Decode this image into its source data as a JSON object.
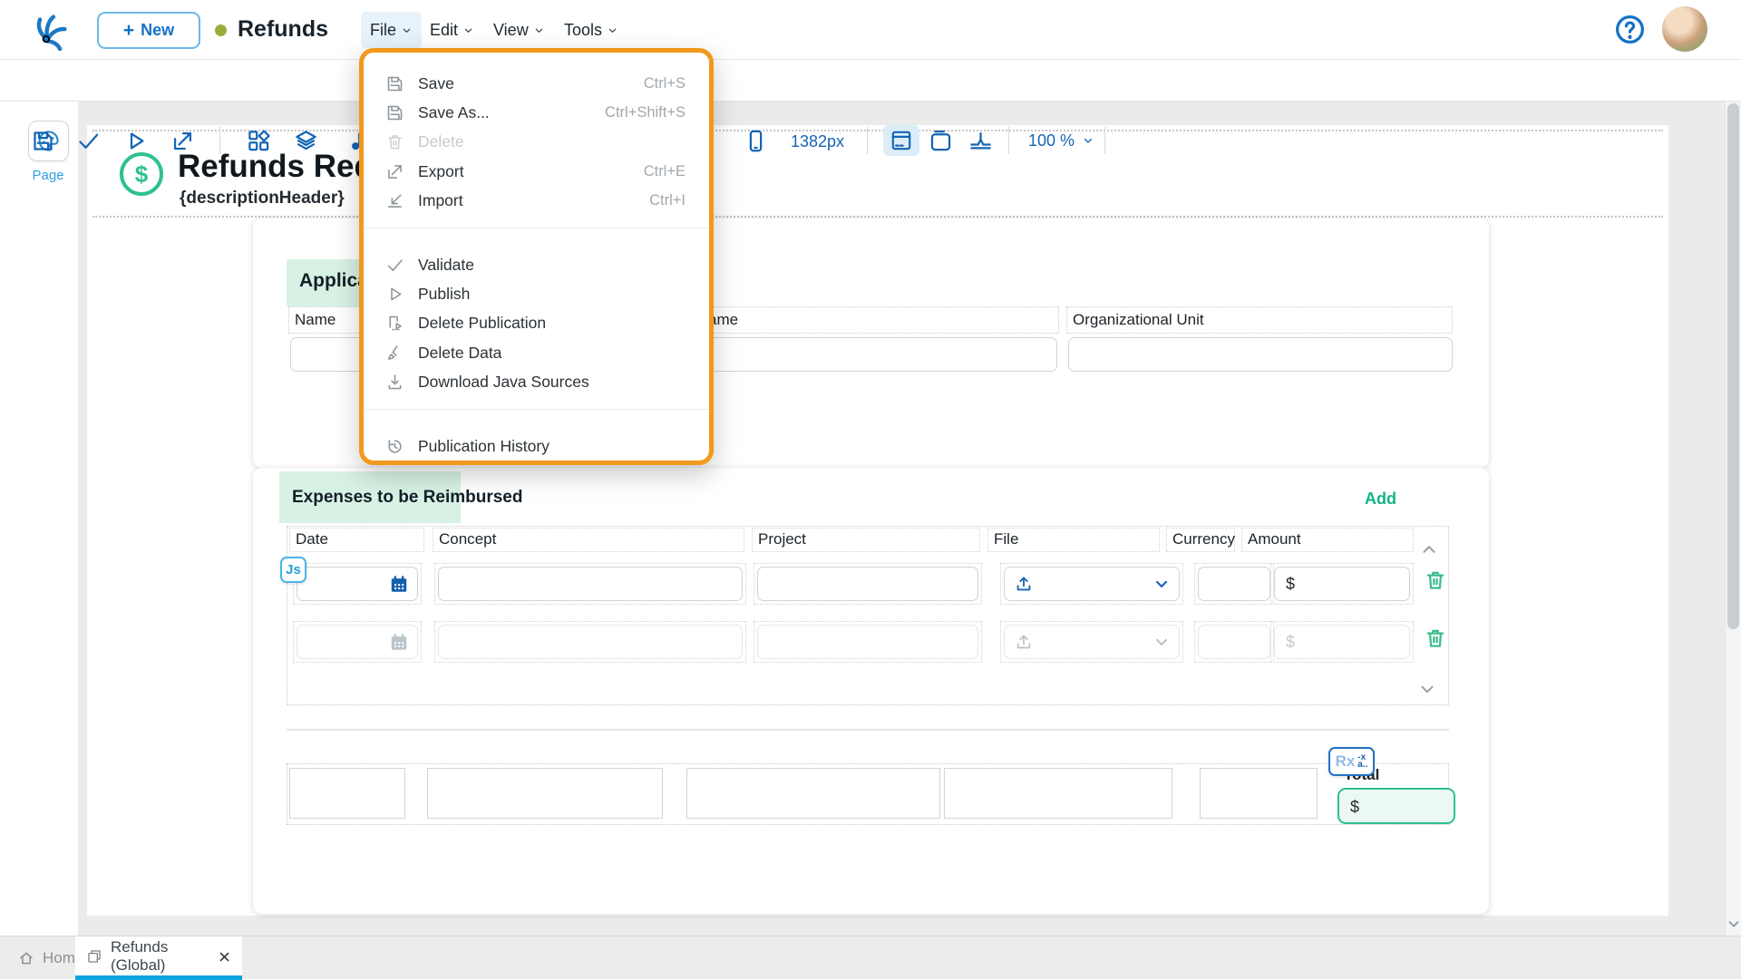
{
  "navbar": {
    "new_button_plus": "+",
    "new_button_label": "New",
    "app_title": "Refunds",
    "menus": [
      {
        "label": "File"
      },
      {
        "label": "Edit"
      },
      {
        "label": "View"
      },
      {
        "label": "Tools"
      }
    ],
    "active_menu": "File"
  },
  "toolbar": {
    "canvas_width_label": "1382px",
    "zoom_label": "100 %"
  },
  "file_menu": {
    "items": [
      {
        "label": "Save",
        "shortcut": "Ctrl+S"
      },
      {
        "label": "Save As...",
        "shortcut": "Ctrl+Shift+S"
      },
      {
        "label": "Delete",
        "disabled": true
      },
      {
        "label": "Export",
        "shortcut": "Ctrl+E"
      },
      {
        "label": "Import",
        "shortcut": "Ctrl+I"
      },
      {
        "label": "Validate"
      },
      {
        "label": "Publish"
      },
      {
        "label": "Delete Publication"
      },
      {
        "label": "Delete Data"
      },
      {
        "label": "Download Java Sources"
      },
      {
        "label": "Publication History"
      }
    ]
  },
  "sidebar": {
    "page_label": "Page"
  },
  "form": {
    "header_icon_symbol": "$",
    "header_title": "Refunds Requ",
    "header_description": "{descriptionHeader}",
    "section_tab_label": "Applica",
    "fields": [
      {
        "label": "Name"
      },
      {
        "label": "ame"
      },
      {
        "label": "Organizational Unit"
      }
    ],
    "expenses": {
      "section_title": "Expenses to be Reimbursed",
      "add_label": "Add",
      "columns": [
        "Date",
        "Concept",
        "Project",
        "File",
        "Currency",
        "Amount"
      ],
      "currency_symbol": "$",
      "js_badge_label": "Js",
      "rx_badge_label": "Rx",
      "rx_formula_top": "-x",
      "rx_formula_bottom": "a..",
      "total_label": "Total"
    }
  },
  "tab_bar": {
    "tabs": [
      {
        "label": "Home"
      },
      {
        "label": "Refunds (Global)"
      }
    ],
    "active_tab": "Refunds (Global)"
  },
  "icons": {
    "logo-icon": "blue claw mark",
    "save-icon": "floppy disk",
    "validate-icon": "checkmark",
    "publish-icon": "play triangle",
    "export-icon": "arrow up-right",
    "import-icon": "arrow down-left",
    "delete-icon": "trash can",
    "download-icon": "arrow into tray",
    "history-icon": "clock with arrow",
    "calendar-icon": "calendar",
    "upload-icon": "arrow out of tray",
    "palette-icon": "paint palette",
    "help-icon": "question mark circle"
  },
  "colors": {
    "accent_blue": "#1565b4",
    "highlight_orange": "#f2991d",
    "mint_highlight": "#d7f2e4",
    "accent_green": "#2dc08e",
    "add_link_green": "#10b585",
    "tab_underline_blue": "#0ea5e0",
    "status_dot_olive": "#9aad3b",
    "canvas_gray": "#ebebeb"
  }
}
